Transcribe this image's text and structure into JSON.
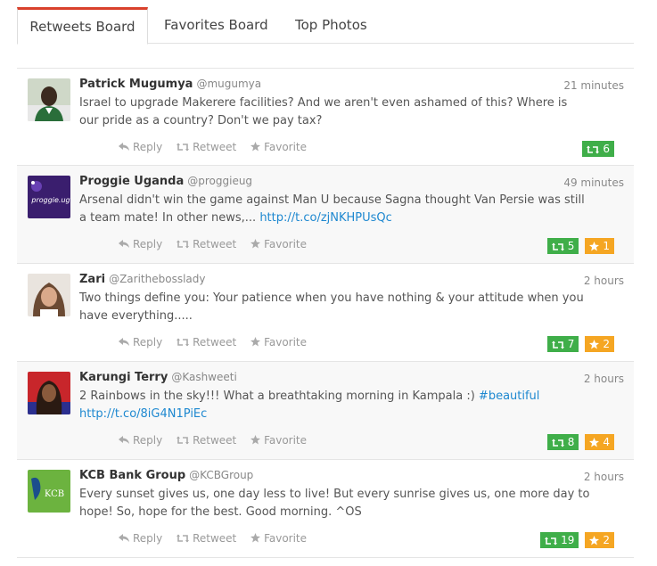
{
  "tabs": [
    {
      "label": "Retweets Board"
    },
    {
      "label": "Favorites Board"
    },
    {
      "label": "Top Photos"
    }
  ],
  "actions": {
    "reply": "Reply",
    "retweet": "Retweet",
    "favorite": "Favorite"
  },
  "colors": {
    "retweet_badge": "#3fae49",
    "favorite_badge": "#f5a623",
    "active_tab": "#d9412c",
    "link": "#1e88d0"
  },
  "tweets": [
    {
      "name": "Patrick Mugumya",
      "handle": "@mugumya",
      "time": "21 minutes",
      "text": "Israel to upgrade Makerere facilities? And we aren't even ashamed of this? Where is our pride as a country? Don't we pay tax?",
      "link": "",
      "retweets": "6",
      "favorites": ""
    },
    {
      "name": "Proggie Uganda",
      "handle": "@proggieug",
      "time": "49 minutes",
      "text": "Arsenal didn't win the game against Man U because Sagna thought Van Persie was still a team mate! In other news,... ",
      "link": "http://t.co/zjNKHPUsQc",
      "avatar_text": "proggie.ug",
      "retweets": "5",
      "favorites": "1"
    },
    {
      "name": "Zari",
      "handle": "@Zarithebosslady",
      "time": "2 hours",
      "text": "Two things define you: Your patience when you have nothing & your attitude when you have everything.....",
      "link": "",
      "retweets": "7",
      "favorites": "2"
    },
    {
      "name": "Karungi Terry",
      "handle": "@Kashweeti",
      "time": "2 hours",
      "text": "2 Rainbows in the sky!!! What a breathtaking morning in Kampala :) ",
      "hashtag": "#beautiful",
      "link": "http://t.co/8iG4N1PiEc",
      "retweets": "8",
      "favorites": "4"
    },
    {
      "name": "KCB Bank Group",
      "handle": "@KCBGroup",
      "time": "2 hours",
      "text": "Every sunset gives us, one day less to live! But every sunrise gives us, one more day to hope! So, hope for the best. Good morning. ^OS",
      "link": "",
      "avatar_text": "KCB",
      "retweets": "19",
      "favorites": "2"
    }
  ]
}
